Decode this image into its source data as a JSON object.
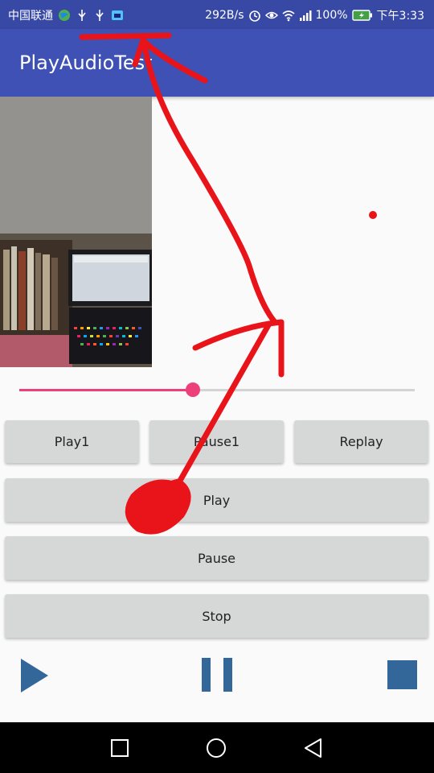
{
  "status_bar": {
    "carrier": "中国联通",
    "net_speed": "292B/s",
    "battery": "100%",
    "time": "下午3:33"
  },
  "app_bar": {
    "title": "PlayAudioTest"
  },
  "seek_bar": {
    "progress": 0.44
  },
  "buttons": {
    "play1": "Play1",
    "pause1": "Pause1",
    "replay": "Replay",
    "play": "Play",
    "pause": "Pause",
    "stop": "Stop"
  },
  "icons": {
    "play": "play-icon",
    "pause": "pause-icon",
    "stop": "stop-icon"
  },
  "colors": {
    "primary": "#3f51b5",
    "status_bar": "#3848a5",
    "accent": "#ec407a",
    "media_icon": "#336699",
    "annotation": "#e8141a"
  }
}
